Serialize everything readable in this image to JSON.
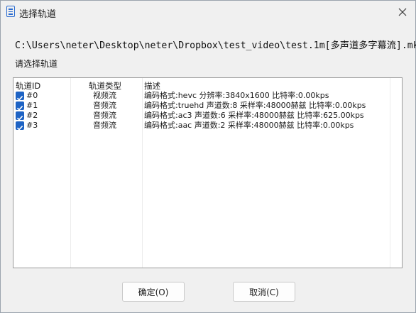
{
  "window": {
    "title": "选择轨道",
    "icon": "list-document-icon"
  },
  "file_path": "C:\\Users\\neter\\Desktop\\neter\\Dropbox\\test_video\\test.1m[多声道多字幕流].mkv",
  "prompt": "请选择轨道",
  "table": {
    "columns": [
      "轨道ID",
      "轨道类型",
      "描述"
    ],
    "rows": [
      {
        "checked": true,
        "id": "#0",
        "type": "视频流",
        "desc": "编码格式:hevc 分辨率:3840x1600 比特率:0.00kps"
      },
      {
        "checked": true,
        "id": "#1",
        "type": "音频流",
        "desc": "编码格式:truehd 声道数:8 采样率:48000赫兹 比特率:0.00kps"
      },
      {
        "checked": true,
        "id": "#2",
        "type": "音频流",
        "desc": "编码格式:ac3 声道数:6 采样率:48000赫兹 比特率:625.00kps"
      },
      {
        "checked": true,
        "id": "#3",
        "type": "音频流",
        "desc": "编码格式:aac 声道数:2 采样率:48000赫兹 比特率:0.00kps"
      }
    ]
  },
  "buttons": {
    "ok": "确定(O)",
    "cancel": "取消(C)"
  },
  "colors": {
    "accent": "#1e63c4",
    "background": "#f0f0f0",
    "list_background": "#ffffff"
  }
}
